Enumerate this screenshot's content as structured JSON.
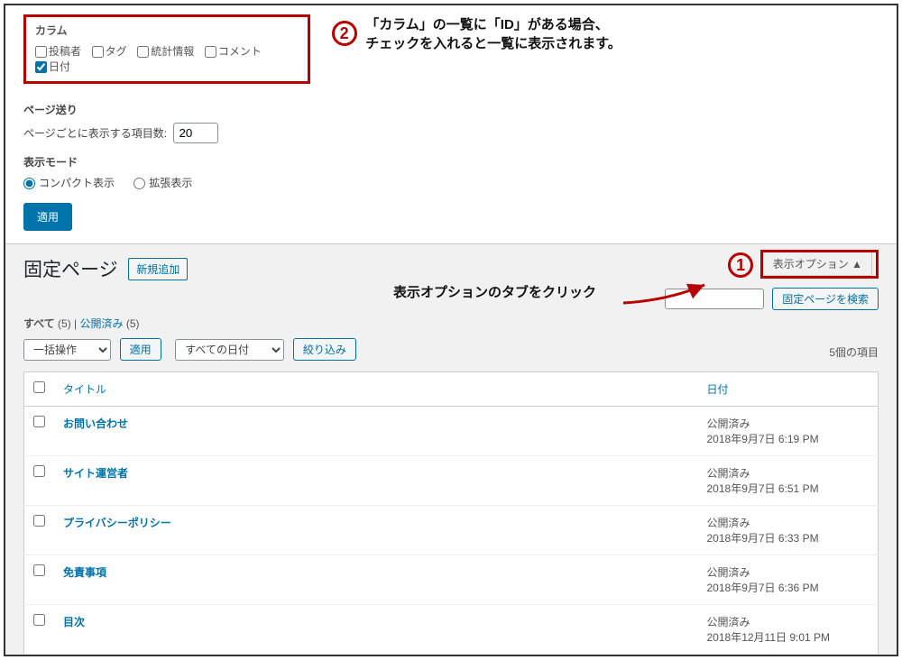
{
  "screen_options": {
    "columns_legend": "カラム",
    "columns": [
      {
        "label": "投稿者",
        "checked": false
      },
      {
        "label": "タグ",
        "checked": false
      },
      {
        "label": "統計情報",
        "checked": false
      },
      {
        "label": "コメント",
        "checked": false
      },
      {
        "label": "日付",
        "checked": true
      }
    ],
    "pagination_legend": "ページ送り",
    "items_per_page_label": "ページごとに表示する項目数:",
    "items_per_page_value": "20",
    "view_mode_legend": "表示モード",
    "view_modes": {
      "compact_label": "コンパクト表示",
      "extended_label": "拡張表示",
      "selected": "compact"
    },
    "apply_label": "適用"
  },
  "annotations": {
    "circ2": "2",
    "circ2_text_line1": "「カラム」の一覧に「ID」がある場合、",
    "circ2_text_line2": "チェックを入れると一覧に表示されます。",
    "circ1": "1",
    "circ1_text": "表示オプションのタブをクリック"
  },
  "page": {
    "title": "固定ページ",
    "add_new_label": "新規追加",
    "screen_options_tab": "表示オプション ▲"
  },
  "subsub": {
    "all_label": "すべて",
    "all_count": "(5)",
    "sep": "|",
    "published_label": "公開済み",
    "published_count": "(5)"
  },
  "filters": {
    "bulk_action": "一括操作",
    "apply": "適用",
    "date_filter": "すべての日付",
    "filter_button": "絞り込み"
  },
  "search": {
    "button": "固定ページを検索",
    "value": ""
  },
  "listnav": {
    "item_count": "5個の項目"
  },
  "table": {
    "col_title": "タイトル",
    "col_date": "日付",
    "rows": [
      {
        "title": "お問い合わせ",
        "status": "公開済み",
        "date": "2018年9月7日 6:19 PM"
      },
      {
        "title": "サイト運営者",
        "status": "公開済み",
        "date": "2018年9月7日 6:51 PM"
      },
      {
        "title": "プライバシーポリシー",
        "status": "公開済み",
        "date": "2018年9月7日 6:33 PM"
      },
      {
        "title": "免責事項",
        "status": "公開済み",
        "date": "2018年9月7日 6:36 PM"
      },
      {
        "title": "目次",
        "status": "公開済み",
        "date": "2018年12月11日 9:01 PM"
      }
    ]
  }
}
